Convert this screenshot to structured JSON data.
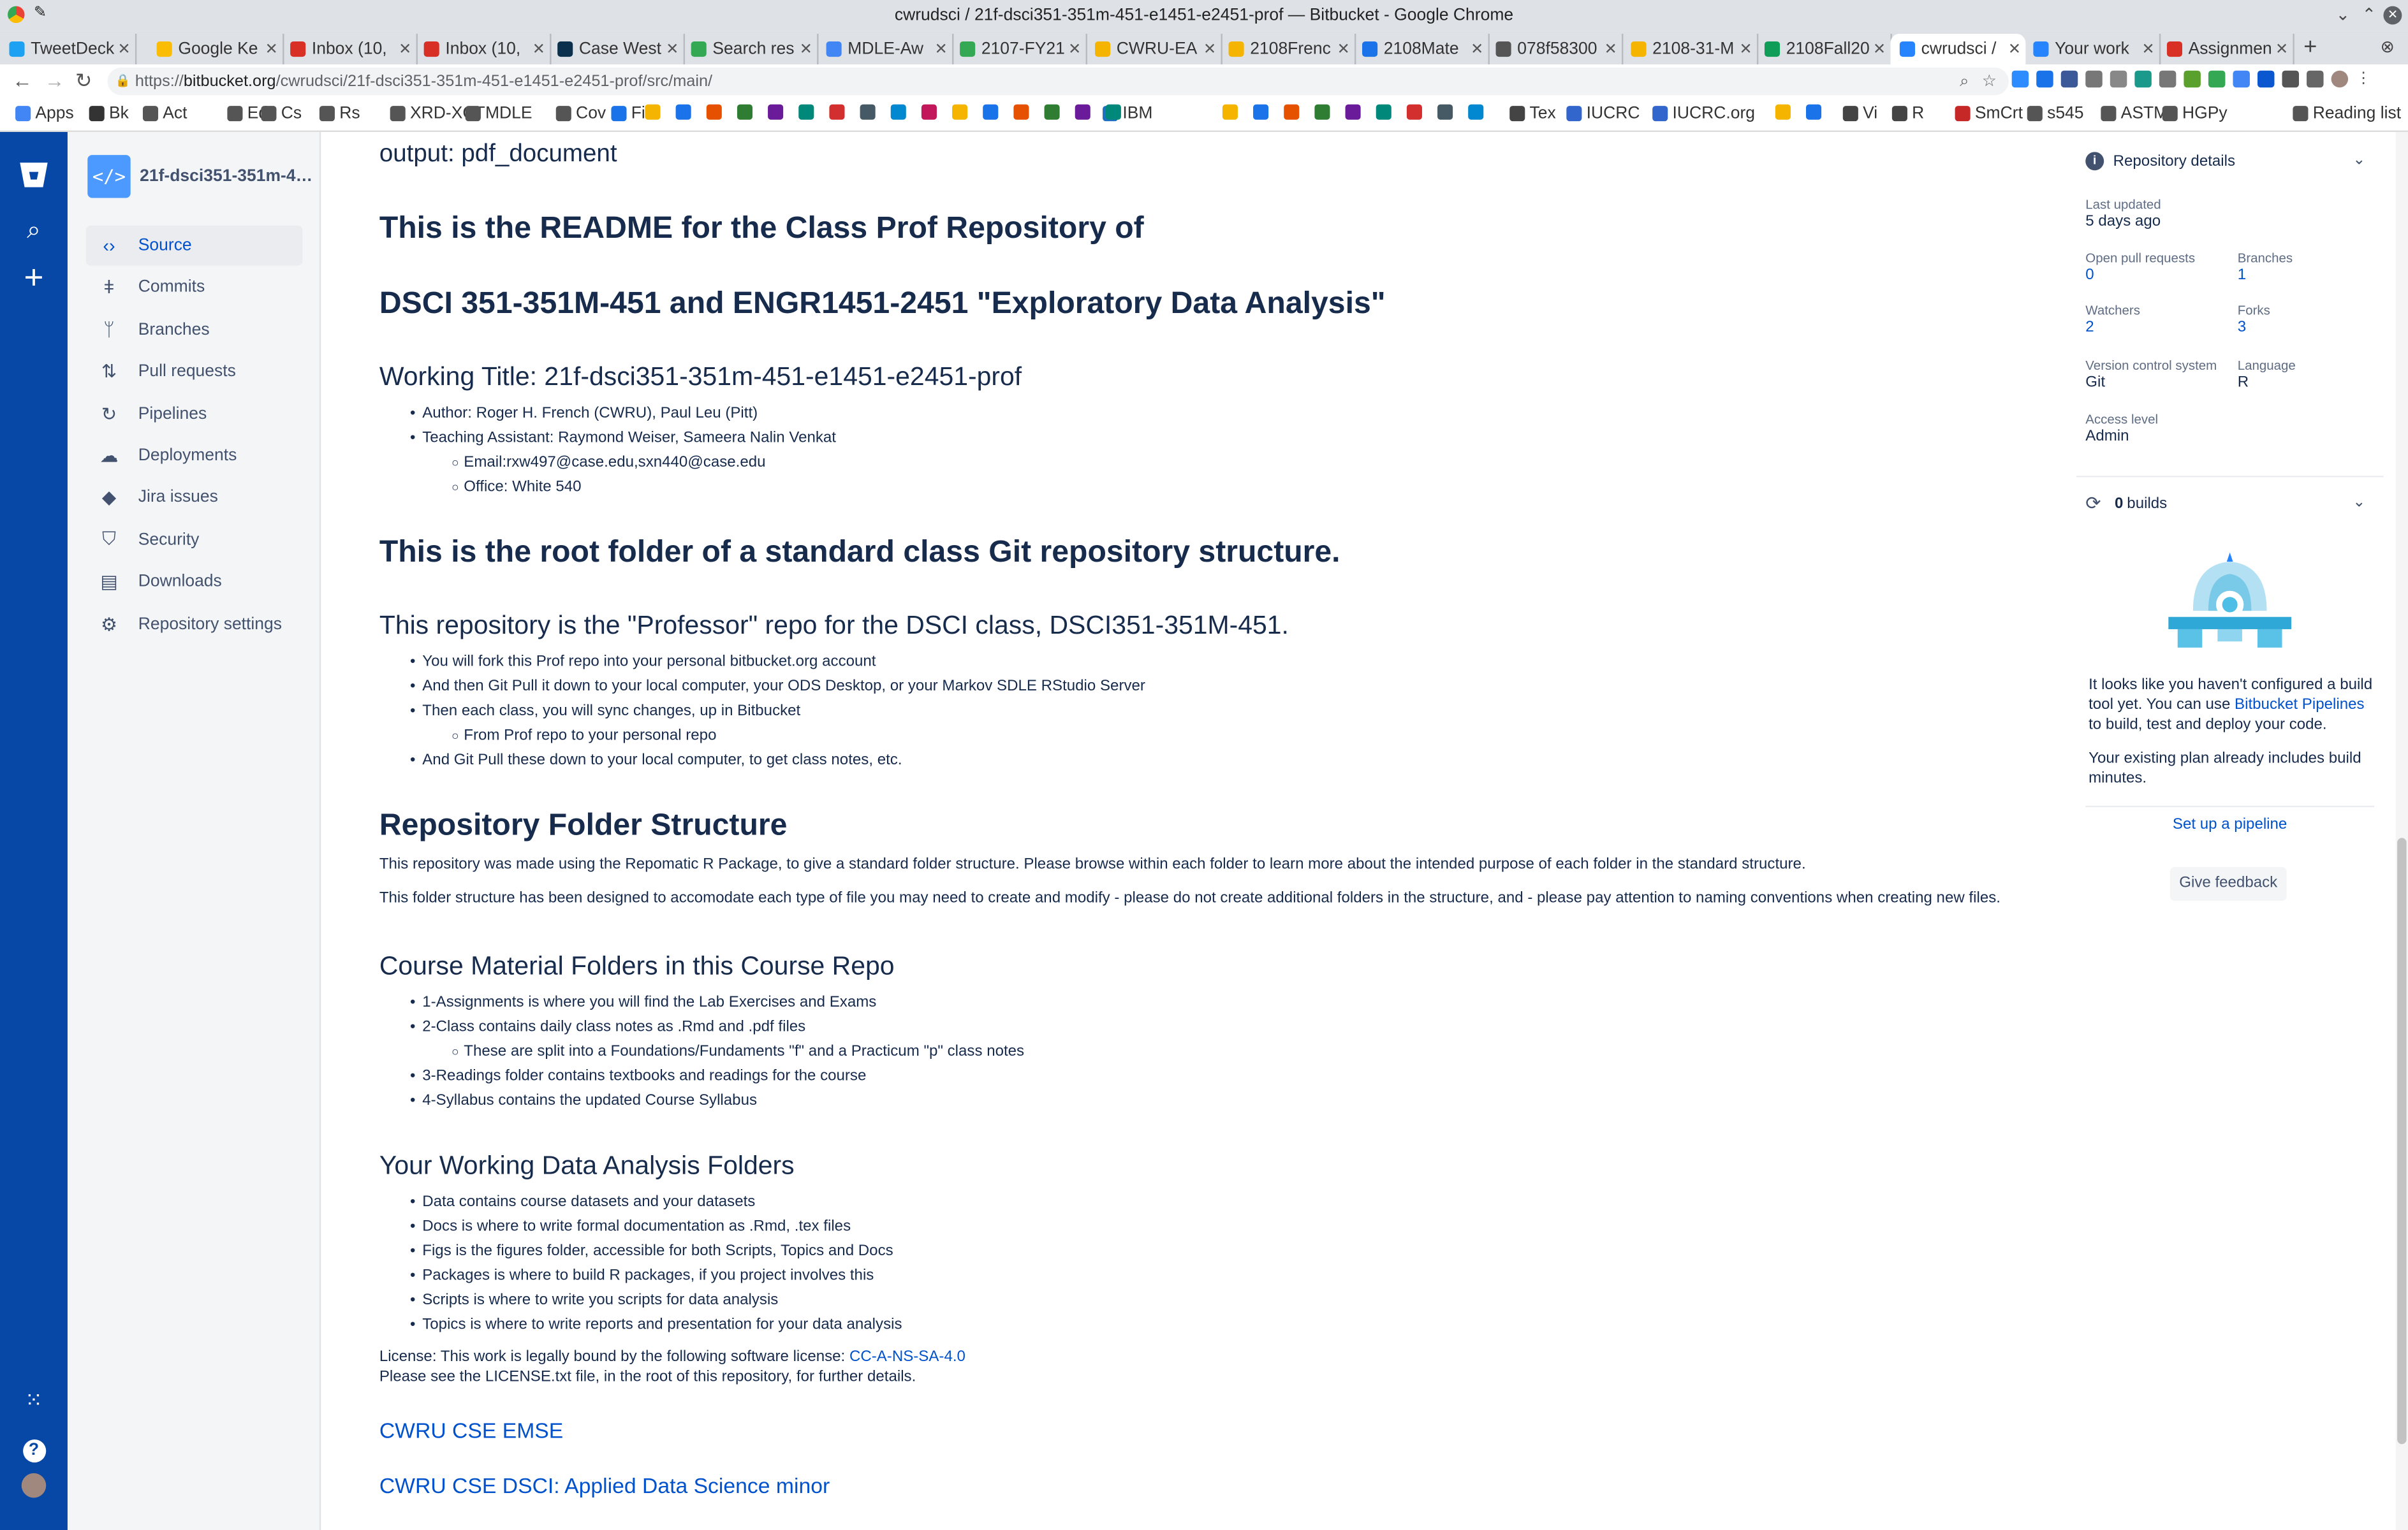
{
  "window": {
    "title": "cwrudsci / 21f-dsci351-351m-451-e1451-e2451-prof — Bitbucket - Google Chrome"
  },
  "tabs": [
    {
      "label": "TweetDeck",
      "color": "#1da1f2"
    },
    {
      "label": "Google Ke",
      "color": "#fbbc04"
    },
    {
      "label": "Inbox (10,",
      "color": "#d93025"
    },
    {
      "label": "Inbox (10,",
      "color": "#d93025"
    },
    {
      "label": "Case West",
      "color": "#0a304e"
    },
    {
      "label": "Search res",
      "color": "#34a853"
    },
    {
      "label": "MDLE-Aw",
      "color": "#4285f4"
    },
    {
      "label": "2107-FY21",
      "color": "#34a853"
    },
    {
      "label": "CWRU-EA",
      "color": "#f4b400"
    },
    {
      "label": "2108Frenc",
      "color": "#f4b400"
    },
    {
      "label": "2108Mate",
      "color": "#1a73e8"
    },
    {
      "label": "078f58300",
      "color": "#555555"
    },
    {
      "label": "2108-31-M",
      "color": "#f4b400"
    },
    {
      "label": "2108Fall20",
      "color": "#0f9d58"
    },
    {
      "label": "cwrudsci /",
      "color": "#2684ff"
    },
    {
      "label": "Your work",
      "color": "#2684ff"
    },
    {
      "label": "Assignmen",
      "color": "#d93025"
    }
  ],
  "url": {
    "prefix": "https://",
    "host": "bitbucket.org",
    "path": "/cwrudsci/21f-dsci351-351m-451-e1451-e2451-prof/src/main/"
  },
  "bookmarks": [
    "Apps",
    "Bk",
    "Act",
    "Ed",
    "Cs",
    "Rs",
    "XRD-XCT",
    "MDLE",
    "Cov",
    "Fin",
    "IBM",
    "Tex",
    "IUCRC",
    "IUCRC.org",
    "Vi",
    "R",
    "SmCrt",
    "s545",
    "ASTM",
    "HGPy",
    "Reading list"
  ],
  "repo": {
    "name": "21f-dsci351-351m-451-e1451-e2451-prof",
    "avatar_glyph": "</>"
  },
  "nav": [
    {
      "label": "Source",
      "icon": "code-icon",
      "glyph": "‹›",
      "active": true
    },
    {
      "label": "Commits",
      "icon": "commit-icon",
      "glyph": "ǂ"
    },
    {
      "label": "Branches",
      "icon": "branch-icon",
      "glyph": "ᛘ"
    },
    {
      "label": "Pull requests",
      "icon": "pull-request-icon",
      "glyph": "⇅"
    },
    {
      "label": "Pipelines",
      "icon": "pipelines-icon",
      "glyph": "↻"
    },
    {
      "label": "Deployments",
      "icon": "deployments-icon",
      "glyph": "☁"
    },
    {
      "label": "Jira issues",
      "icon": "jira-icon",
      "glyph": "◆"
    },
    {
      "label": "Security",
      "icon": "shield-icon",
      "glyph": "⛉"
    },
    {
      "label": "Downloads",
      "icon": "download-icon",
      "glyph": "▤"
    },
    {
      "label": "Repository settings",
      "icon": "gear-icon",
      "glyph": "⚙"
    }
  ],
  "readme": {
    "output_line": "output: pdf_document",
    "h_readme": "This is the README for the Class Prof Repository of",
    "h_course": "DSCI 351-351M-451 and ENGR1451-2451 \"Exploratory Data Analysis\"",
    "h_working": "Working Title: 21f-dsci351-351m-451-e1451-e2451-prof",
    "people": [
      {
        "text": "Author: Roger H. French (CWRU), Paul Leu (Pitt)",
        "sub": false
      },
      {
        "text": "Teaching Assistant: Raymond Weiser, Sameera Nalin Venkat",
        "sub": false
      },
      {
        "text": "Email:rxw497@case.edu,sxn440@case.edu",
        "sub": true
      },
      {
        "text": "Office: White 540",
        "sub": true
      }
    ],
    "h_root": "This is the root folder of a standard class Git repository structure.",
    "h_prof": "This repository is the \"Professor\" repo for the DSCI class, DSCI351-351M-451.",
    "prof_items": [
      {
        "text": "You will fork this Prof repo into your personal bitbucket.org account",
        "sub": false
      },
      {
        "text": "And then Git Pull it down to your local computer, your ODS Desktop, or your Markov SDLE RStudio Server",
        "sub": false
      },
      {
        "text": "Then each class, you will sync changes, up in Bitbucket",
        "sub": false
      },
      {
        "text": "From Prof repo to your personal repo",
        "sub": true
      },
      {
        "text": "And Git Pull these down to your local computer, to get class notes, etc.",
        "sub": false
      }
    ],
    "h_structure": "Repository Folder Structure",
    "structure_p1": "This repository was made using the Repomatic R Package, to give a standard folder structure. Please browse within each folder to learn more about the intended purpose of each folder in the standard structure.",
    "structure_p2": "This folder structure has been designed to accomodate each type of file you may need to create and modify - please do not create additional folders in the structure, and - please pay attention to naming conventions when creating new files.",
    "h_course_folders": "Course Material Folders in this Course Repo",
    "course_items": [
      {
        "text": "1-Assignments is where you will find the Lab Exercises and Exams",
        "sub": false
      },
      {
        "text": "2-Class contains daily class notes as .Rmd and .pdf files",
        "sub": false
      },
      {
        "text": "These are split into a Foundations/Fundaments \"f\" and a Practicum \"p\" class notes",
        "sub": true
      },
      {
        "text": "3-Readings folder contains textbooks and readings for the course",
        "sub": false
      },
      {
        "text": "4-Syllabus contains the updated Course Syllabus",
        "sub": false
      }
    ],
    "h_working_folders": "Your Working Data Analysis Folders",
    "working_items": [
      {
        "text": "Data contains course datasets and your datasets",
        "sub": false
      },
      {
        "text": "Docs is where to write formal documentation as .Rmd, .tex files",
        "sub": false
      },
      {
        "text": "Figs is the figures folder, accessible for both Scripts, Topics and Docs",
        "sub": false
      },
      {
        "text": "Packages is where to build R packages, if you project involves this",
        "sub": false
      },
      {
        "text": "Scripts is where to write you scripts for data analysis",
        "sub": false
      },
      {
        "text": "Topics is where to write reports and presentation for your data analysis",
        "sub": false
      }
    ],
    "license_text": "License: This work is legally bound by the following software license: ",
    "license_link": "CC-A-NS-SA-4.0",
    "license_note": "Please see the LICENSE.txt file, in the root of this repository, for further details.",
    "link_emse": "CWRU CSE EMSE",
    "link_dsci": "CWRU CSE DSCI: Applied Data Science minor"
  },
  "details": {
    "header": "Repository details",
    "last_updated_label": "Last updated",
    "last_updated": "5 days ago",
    "open_pr_label": "Open pull requests",
    "open_pr": "0",
    "branches_label": "Branches",
    "branches": "1",
    "watchers_label": "Watchers",
    "watchers": "2",
    "forks_label": "Forks",
    "forks": "3",
    "vcs_label": "Version control system",
    "vcs": "Git",
    "language_label": "Language",
    "language": "R",
    "access_label": "Access level",
    "access": "Admin"
  },
  "builds": {
    "count": "0",
    "label": "builds",
    "message_1": "It looks like you haven't configured a build tool yet. You can use ",
    "message_link": "Bitbucket Pipelines",
    "message_2": " to build, test and deploy your code.",
    "plan_note": "Your existing plan already includes build minutes.",
    "setup": "Set up a pipeline",
    "feedback": "Give feedback"
  }
}
